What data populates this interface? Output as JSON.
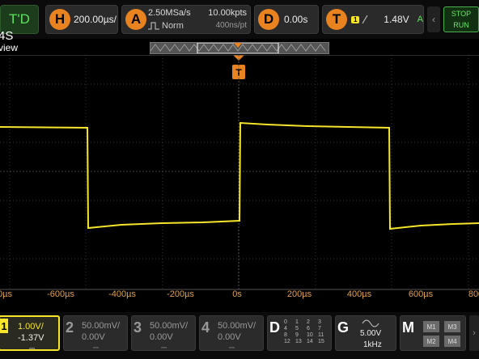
{
  "top": {
    "trigger_mode": "T'D",
    "horizontal_label": "H",
    "timebase": "200.00µs/",
    "acquire_label": "A",
    "sample_rate": "2.50MSa/s",
    "acquire_mode": "Norm",
    "mem_depth": "10.00kpts",
    "time_per_point": "400ns/pt",
    "delay_label": "D",
    "delay_value": "0.00s",
    "trigger_label": "T",
    "trigger_source": "1",
    "trigger_level": "1.48V",
    "trigger_auto": "A",
    "stop_label": "STOP",
    "run_label": "RUN"
  },
  "channel_title": "4S",
  "channel_subtitle": "view",
  "trigger_marker": "T",
  "x_axis_labels": [
    "0µs",
    "-600µs",
    "-400µs",
    "-200µs",
    "0s",
    "200µs",
    "400µs",
    "600µs",
    "800"
  ],
  "bottom": {
    "ch1": {
      "num": "1",
      "scale": "1.00V/",
      "offset": "-1.37V"
    },
    "ch2": {
      "num": "2",
      "scale": "50.00mV/",
      "offset": "0.00V"
    },
    "ch3": {
      "num": "3",
      "scale": "50.00mV/",
      "offset": "0.00V"
    },
    "ch4": {
      "num": "4",
      "scale": "50.00mV/",
      "offset": "0.00V"
    },
    "digital_label": "D",
    "digital_channels": [
      "0",
      "1",
      "2",
      "3",
      "4",
      "5",
      "6",
      "7",
      "8",
      "9",
      "10",
      "11",
      "12",
      "13",
      "14",
      "15"
    ],
    "gen_label": "G",
    "gen_amplitude": "5.00V",
    "gen_freq": "1kHz",
    "math_label": "M",
    "math_buttons": [
      "M1",
      "M3",
      "M2",
      "M4"
    ]
  },
  "colors": {
    "ch1": "#f5e62a",
    "accent": "#e8831f",
    "grid": "#3a3a3a"
  }
}
